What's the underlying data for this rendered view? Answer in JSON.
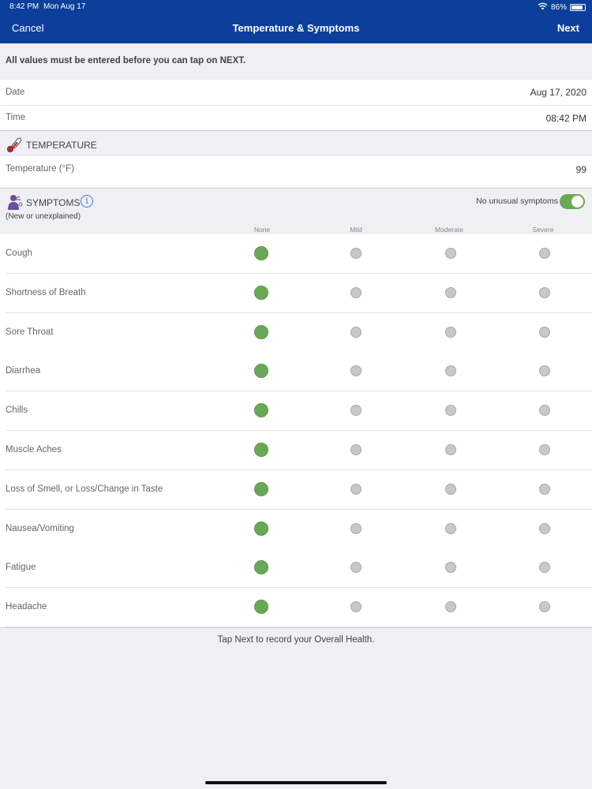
{
  "status_bar": {
    "time": "8:42 PM",
    "date": "Mon Aug 17",
    "battery": "86%",
    "battery_level": 0.86
  },
  "nav": {
    "cancel": "Cancel",
    "title": "Temperature & Symptoms",
    "next": "Next"
  },
  "notice": "All values must be entered before you can tap on NEXT.",
  "date_row": {
    "label": "Date",
    "value": "Aug 17, 2020"
  },
  "time_row": {
    "label": "Time",
    "value": "08:42 PM"
  },
  "temperature": {
    "section_title": "TEMPERATURE",
    "label": "Temperature (°F)",
    "value": "99",
    "icon": "thermometer-icon"
  },
  "symptoms": {
    "section_title": "SYMPTOMS",
    "subtitle": "(New or unexplained)",
    "toggle_label": "No unusual symptoms",
    "toggle_on": true,
    "columns": [
      "None",
      "Mild",
      "Moderate",
      "Severe"
    ],
    "items": [
      {
        "label": "Cough",
        "selected": "None"
      },
      {
        "label": "Shortness of Breath",
        "selected": "None"
      },
      {
        "label": "Sore Throat",
        "selected": "None"
      },
      {
        "label": "Diarrhea",
        "selected": "None"
      },
      {
        "label": "Chills",
        "selected": "None"
      },
      {
        "label": "Muscle Aches",
        "selected": "None"
      },
      {
        "label": "Loss of Smell, or Loss/Change in Taste",
        "selected": "None"
      },
      {
        "label": "Nausea/Vomiting",
        "selected": "None"
      },
      {
        "label": "Fatigue",
        "selected": "None"
      },
      {
        "label": "Headache",
        "selected": "None"
      }
    ]
  },
  "footer": "Tap Next to record your Overall Health.",
  "colors": {
    "header": "#0b3f9b",
    "selected": "#6aa857",
    "unselected": "#c8c8c8"
  }
}
